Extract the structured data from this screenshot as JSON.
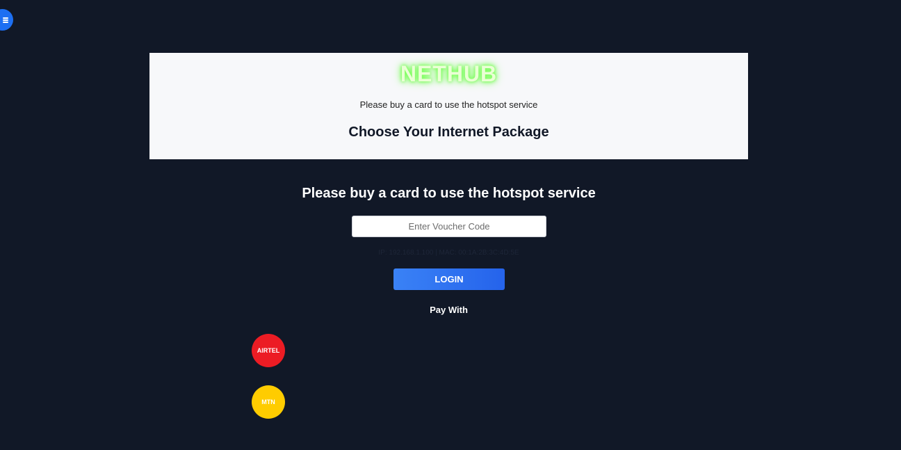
{
  "menu": {
    "icon": "hamburger-menu-icon",
    "color": "#1d6ff2"
  },
  "header": {
    "brand": "NETHUB",
    "subtitle": "Please buy a card to use the hotspot service",
    "title": "Choose Your Internet Package"
  },
  "main": {
    "heading": "Please buy a card to use the hotspot service",
    "voucher_placeholder": "Enter Voucher Code",
    "voucher_value": "",
    "device_info": "IP: 192.168.1.100 | MAC: 00:1A:2B:3C:4D:5E",
    "login_label": "LOGIN",
    "pay_with_label": "Pay With"
  },
  "payment_options": [
    {
      "label": "AIRTEL",
      "color": "#ec1c24"
    },
    {
      "label": "MTN",
      "color": "#ffcc00"
    }
  ],
  "colors": {
    "background": "#111827",
    "accent": "#2563eb",
    "brand_glow": "#7dff5a"
  }
}
